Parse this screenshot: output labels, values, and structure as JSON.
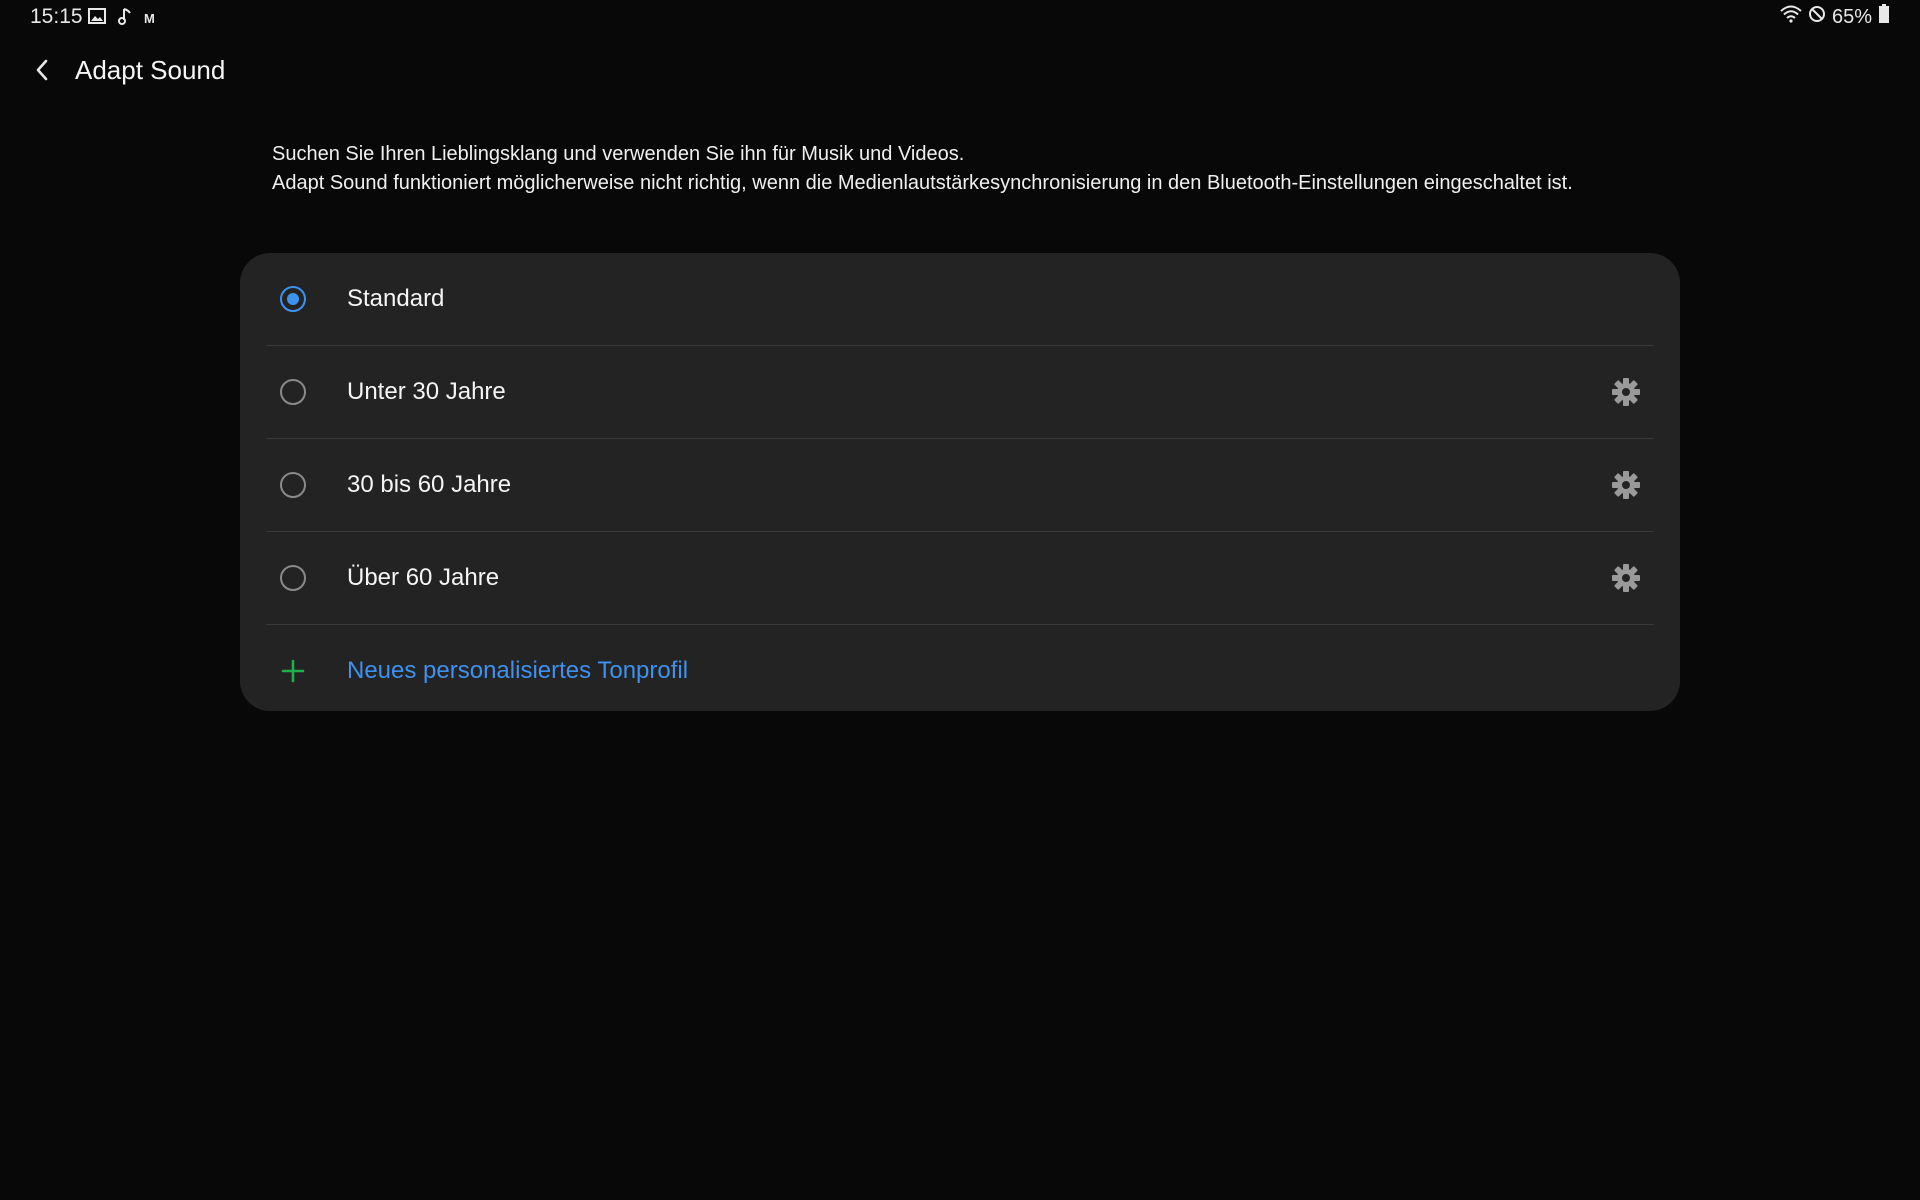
{
  "status_bar": {
    "time": "15:15",
    "notification_icons": [
      "image-icon",
      "music-note-icon",
      "gmail-icon"
    ],
    "gmail_glyph": "M",
    "battery_percent": "65%",
    "right_icons": [
      "wifi-icon",
      "do-not-disturb-icon",
      "battery-icon"
    ]
  },
  "app_bar": {
    "back_icon": "back-arrow-icon",
    "title": "Adapt Sound"
  },
  "description": {
    "line1": "Suchen Sie Ihren Lieblingsklang und verwenden Sie ihn für Musik und Videos.",
    "line2": "Adapt Sound funktioniert möglicherweise nicht richtig, wenn die Medienlautstärkesynchronisierung in den Bluetooth-Einstellungen eingeschaltet ist."
  },
  "options": [
    {
      "label": "Standard",
      "selected": true,
      "has_settings": false
    },
    {
      "label": "Unter 30 Jahre",
      "selected": false,
      "has_settings": true
    },
    {
      "label": "30 bis 60 Jahre",
      "selected": false,
      "has_settings": true
    },
    {
      "label": "Über 60 Jahre",
      "selected": false,
      "has_settings": true
    }
  ],
  "add_profile": {
    "icon": "plus-icon",
    "label": "Neues personalisiertes Tonprofil"
  },
  "colors": {
    "background": "#080808",
    "card": "#232323",
    "accent": "#3e91ee",
    "plus_green": "#1fae4a",
    "gear": "#9a9a9a"
  }
}
